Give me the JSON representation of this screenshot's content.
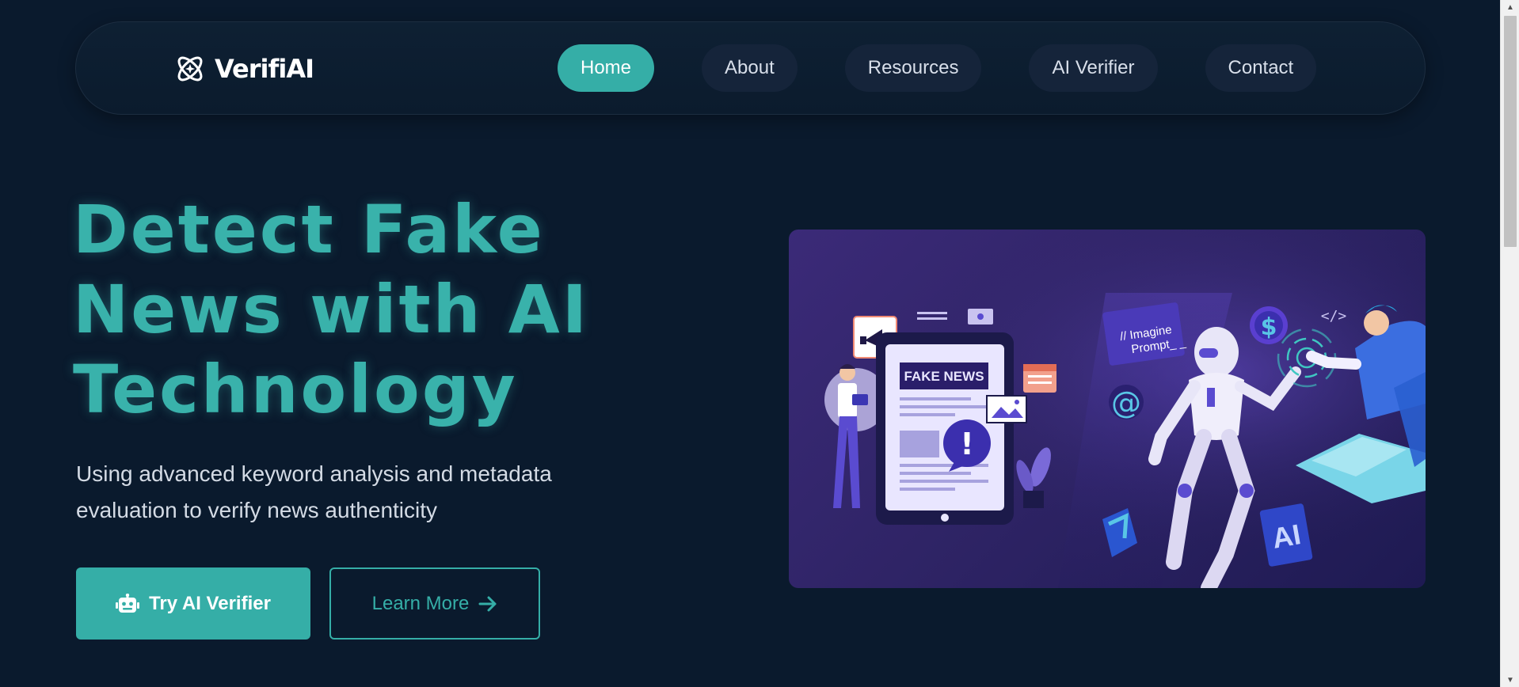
{
  "brand": {
    "name": "VerifiAI",
    "logo_icon": "atom-sparkle-icon"
  },
  "nav": {
    "items": [
      {
        "label": "Home",
        "active": true
      },
      {
        "label": "About",
        "active": false
      },
      {
        "label": "Resources",
        "active": false
      },
      {
        "label": "AI Verifier",
        "active": false
      },
      {
        "label": "Contact",
        "active": false
      }
    ]
  },
  "hero": {
    "title": "Detect Fake News with AI Technology",
    "subtitle": "Using advanced keyword analysis and metadata evaluation to verify news authenticity",
    "primary_button": {
      "label": "Try AI Verifier",
      "icon": "robot-icon"
    },
    "secondary_button": {
      "label": "Learn More",
      "icon": "arrow-right-icon"
    }
  },
  "illustration": {
    "news_label": "FAKE NEWS",
    "prompt_line1": "// Imagine",
    "prompt_line2": "Prompt_ _",
    "code_symbol": "</>",
    "ai_chip_label": "AI",
    "at_symbol": "@",
    "dollar_symbol": "$",
    "alert_symbol": "!"
  },
  "colors": {
    "background": "#0a1a2d",
    "accent": "#35aea7",
    "nav_pill": "#15243a",
    "illustration_bg": "#2f2466"
  }
}
